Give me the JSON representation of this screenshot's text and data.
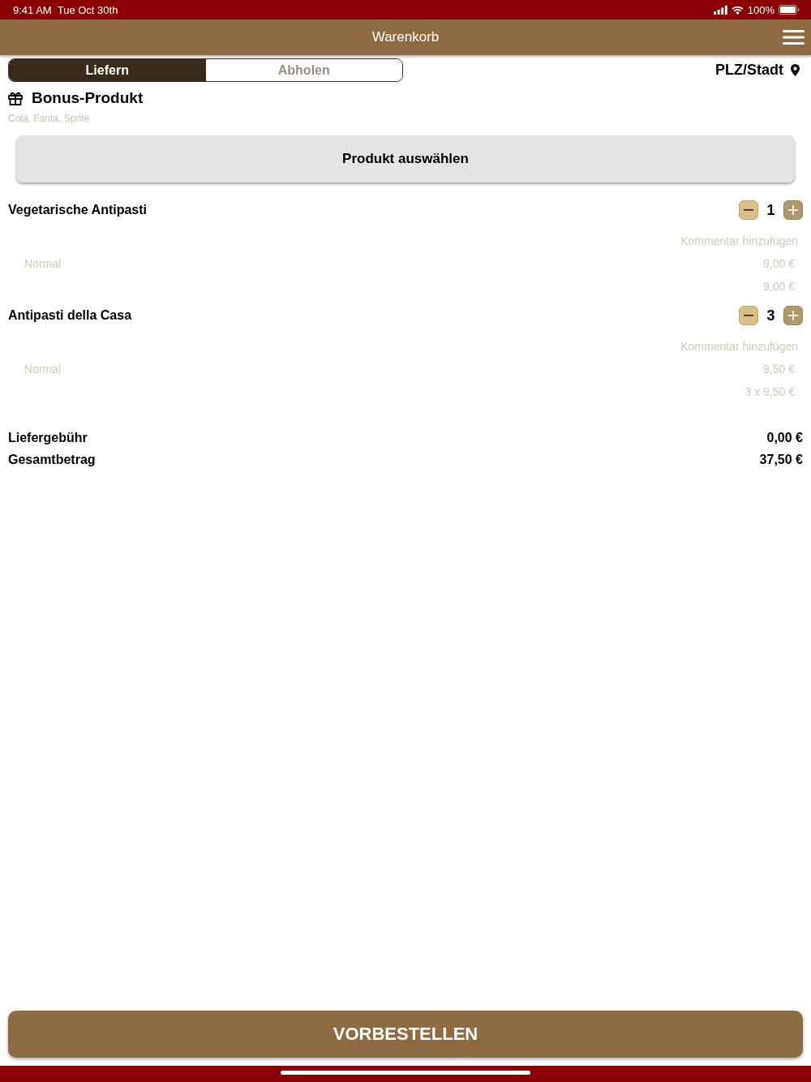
{
  "status_bar": {
    "time": "9:41 AM",
    "date": "Tue Oct 30th",
    "battery": "100%"
  },
  "header": {
    "title": "Warenkorb"
  },
  "order_mode_tabs": [
    {
      "label": "Liefern",
      "selected": true
    },
    {
      "label": "Abholen",
      "selected": false
    }
  ],
  "location": {
    "label": "PLZ/Stadt"
  },
  "bonus": {
    "title": "Bonus-Produkt",
    "options": "Cola, Fanta, Sprite",
    "button": "Produkt auswählen"
  },
  "cart_items": [
    {
      "name": "Vegetarische Antipasti",
      "quantity": "1",
      "comment_link": "Kommentar hinzufügen",
      "variant": "Normal",
      "unit_price": "9,00 €",
      "line_total": "9,00 €"
    },
    {
      "name": "Antipasti della Casa",
      "quantity": "3",
      "comment_link": "Kommentar hinzufügen",
      "variant": "Normal",
      "unit_price": "9,50 €",
      "line_total": "3 x 9,50 €"
    }
  ],
  "summary": [
    {
      "label": "Liefergebühr",
      "value": "0,00 €"
    },
    {
      "label": "Gesamtbetrag",
      "value": "37,50 €"
    }
  ],
  "submit_button": "VORBESTELLEN"
}
